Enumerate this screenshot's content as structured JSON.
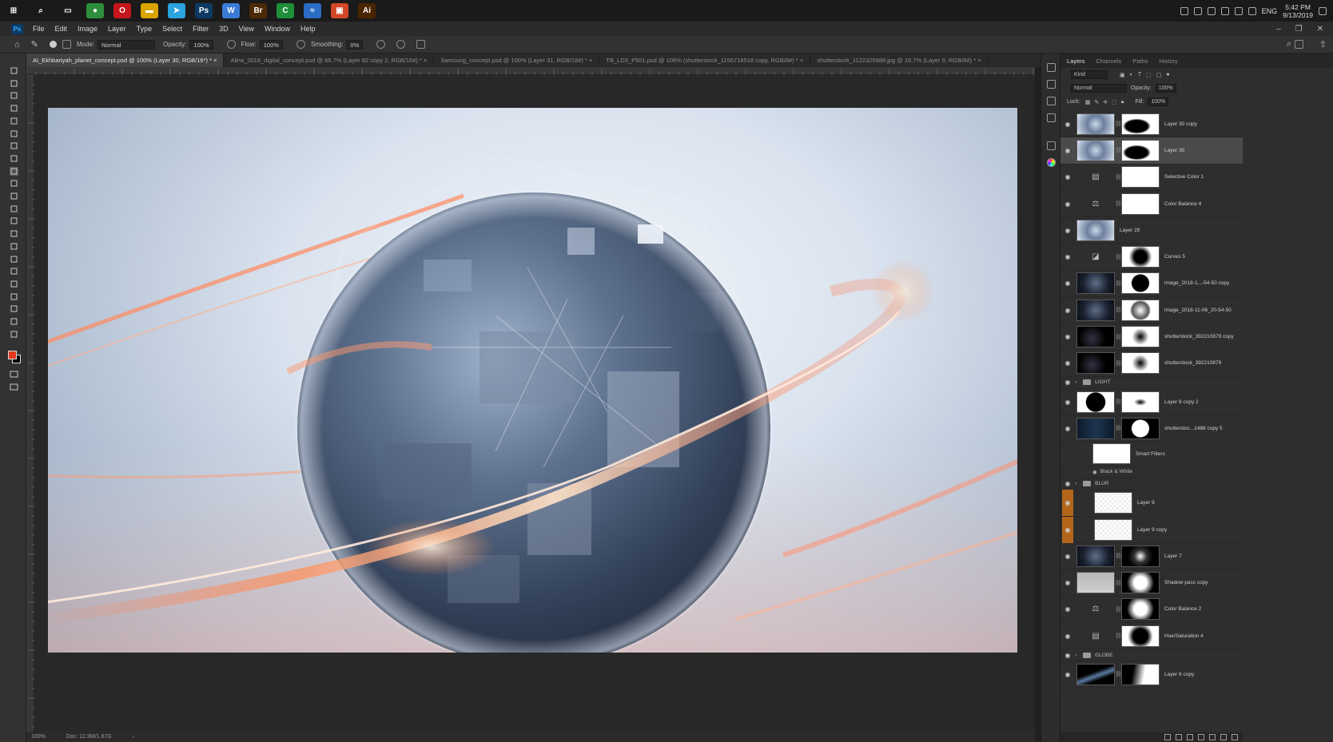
{
  "taskbar": {
    "apps": [
      {
        "icon": "windows-start-icon",
        "glyph": "⊞",
        "color": "#1a1a1a"
      },
      {
        "icon": "search-icon",
        "glyph": "⌕",
        "color": "#1a1a1a"
      },
      {
        "icon": "task-view-icon",
        "glyph": "▭",
        "color": "#1a1a1a"
      },
      {
        "icon": "chrome-icon",
        "glyph": "●",
        "color": "#2d8f3c"
      },
      {
        "icon": "opera-icon",
        "glyph": "O",
        "color": "#c4161c"
      },
      {
        "icon": "file-explorer-icon",
        "glyph": "▬",
        "color": "#d9a300"
      },
      {
        "icon": "telegram-icon",
        "glyph": "➤",
        "color": "#2aa3de"
      },
      {
        "icon": "photoshop-icon",
        "glyph": "Ps",
        "color": "#0d3a63"
      },
      {
        "icon": "app-w-icon",
        "glyph": "W",
        "color": "#3a7bd5"
      },
      {
        "icon": "bridge-icon",
        "glyph": "Br",
        "color": "#4d2a06"
      },
      {
        "icon": "camtasia-icon",
        "glyph": "C",
        "color": "#1f8f3a"
      },
      {
        "icon": "app-wave-icon",
        "glyph": "≈",
        "color": "#2b6cc4"
      },
      {
        "icon": "presentation-icon",
        "glyph": "▣",
        "color": "#d24726"
      },
      {
        "icon": "illustrator-icon",
        "glyph": "Ai",
        "color": "#4a2500"
      }
    ],
    "tray_lang": "ENG",
    "time": "5:42 PM",
    "date": "9/13/2019"
  },
  "menubar": {
    "logo": "Ps",
    "items": [
      "File",
      "Edit",
      "Image",
      "Layer",
      "Type",
      "Select",
      "Filter",
      "3D",
      "View",
      "Window",
      "Help"
    ]
  },
  "options": {
    "mode_label": "Mode:",
    "mode_value": "Normal",
    "opacity_label": "Opacity:",
    "opacity_value": "100%",
    "flow_label": "Flow:",
    "flow_value": "100%",
    "smoothing_label": "Smoothing:",
    "smoothing_value": "0%"
  },
  "tabs": [
    {
      "label": "AI_Ekhbariyah_planet_concept.psd @ 100% (Layer 30, RGB/16*) *",
      "active": true
    },
    {
      "label": "Alina_2018_digital_concept.psd @ 66.7% (Layer 82 copy 2, RGB/16#) *",
      "active": false
    },
    {
      "label": "Samsung_concept.psd @ 100% (Layer 31, RGB/16#) *",
      "active": false
    },
    {
      "label": "TB_LD3_P501.psd @ 106% (shutterstock_1156718518 copy, RGB/8#) *",
      "active": false
    },
    {
      "label": "shutterstock_1122325988.jpg @ 16.7% (Layer 0, RGB/8#) *",
      "active": false
    }
  ],
  "status": {
    "zoom": "100%",
    "doc": "Doc: 12.9M/1.87G"
  },
  "panel": {
    "tabs": [
      "Layers",
      "Channels",
      "Paths",
      "History"
    ],
    "kind_label": "Kind",
    "blend_mode": "Normal",
    "opacity_label": "Opacity:",
    "opacity_value": "100%",
    "lock_label": "Lock:",
    "fill_label": "Fill:",
    "fill_value": "100%"
  },
  "layers": [
    {
      "type": "layer",
      "name": "Layer 30 copy",
      "thumb": "planet",
      "mask": "arc"
    },
    {
      "type": "layer",
      "name": "Layer 30",
      "thumb": "planet",
      "mask": "arc",
      "selected": true
    },
    {
      "type": "adjust",
      "name": "Selective Color 1",
      "icon": "▤",
      "mask": "white"
    },
    {
      "type": "adjust",
      "name": "Color Balance 4",
      "icon": "⚖",
      "mask": "white"
    },
    {
      "type": "layer",
      "name": "Layer 29",
      "thumb": "planet"
    },
    {
      "type": "adjust",
      "name": "Curves 5",
      "icon": "◪",
      "mask": "blob"
    },
    {
      "type": "layer",
      "name": "image_2018-1...-54-50 copy",
      "thumb": "dark-planet",
      "mask": "circle"
    },
    {
      "type": "layer",
      "name": "image_2018-11-06_20-54-50",
      "thumb": "dark-planet",
      "mask": "sketch"
    },
    {
      "type": "layer",
      "name": "shutterstock_392210879 copy",
      "thumb": "black",
      "mask": "soft"
    },
    {
      "type": "layer",
      "name": "shutterstock_392210879",
      "thumb": "black",
      "mask": "soft"
    },
    {
      "type": "group",
      "name": "LIGHT"
    },
    {
      "type": "layer",
      "name": "Layer 8 copy 2",
      "thumb": "black-circle",
      "mask": "brush"
    },
    {
      "type": "layer",
      "name": "shutterstoc...1488 copy 5",
      "thumb": "blue-dark",
      "mask": "circle-white"
    },
    {
      "type": "smart",
      "name": "Smart Filters"
    },
    {
      "type": "filter",
      "name": "Black & White"
    },
    {
      "type": "group",
      "name": "BLUR"
    },
    {
      "type": "layer",
      "name": "Layer 9",
      "thumb": "transparent",
      "orange": true,
      "indent": true
    },
    {
      "type": "layer",
      "name": "Layer 9 copy",
      "thumb": "transparent",
      "orange": true,
      "indent": true
    },
    {
      "type": "layer",
      "name": "Layer 7",
      "thumb": "dark-planet",
      "mask": "swirl"
    },
    {
      "type": "layer",
      "name": "Shadow pass copy",
      "thumb": "gray",
      "mask": "soft-white"
    },
    {
      "type": "adjust",
      "name": "Color Balance 2",
      "icon": "⚖",
      "mask": "soft-white"
    },
    {
      "type": "adjust",
      "name": "Hue/Saturation 4",
      "icon": "▤",
      "mask": "dark-center"
    },
    {
      "type": "group",
      "name": "GLOBE"
    },
    {
      "type": "layer",
      "name": "Layer 6 copy",
      "thumb": "streak",
      "mask": "brush2"
    }
  ]
}
